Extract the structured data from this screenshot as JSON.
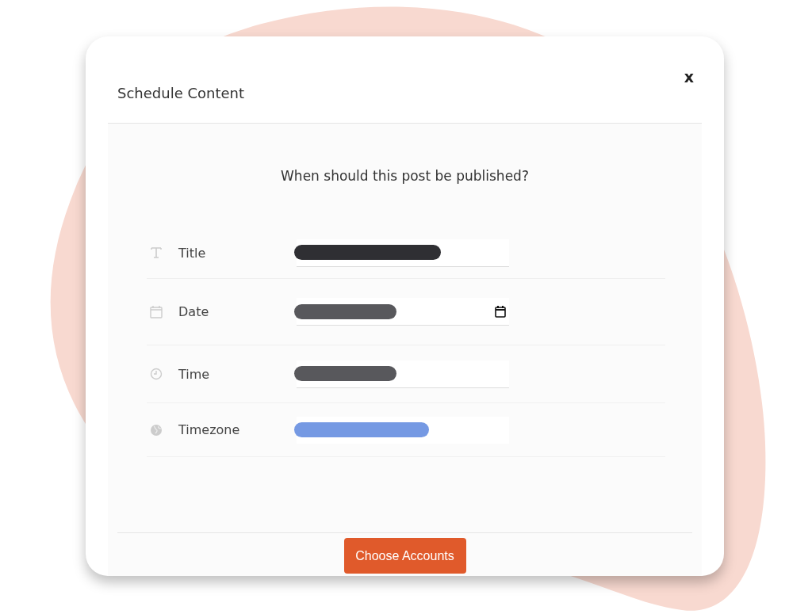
{
  "dialog": {
    "title": "Schedule Content",
    "close": "x"
  },
  "question": "When should this post be published?",
  "fields": [
    {
      "kind": "text",
      "label": "Title",
      "color": "#2f2f33"
    },
    {
      "kind": "date",
      "label": "Date",
      "color": "#58585c"
    },
    {
      "kind": "time",
      "label": "Time",
      "color": "#58585c"
    },
    {
      "kind": "timezone",
      "label": "Timezone",
      "color": "#7599e3"
    }
  ],
  "button": "Choose Accounts"
}
